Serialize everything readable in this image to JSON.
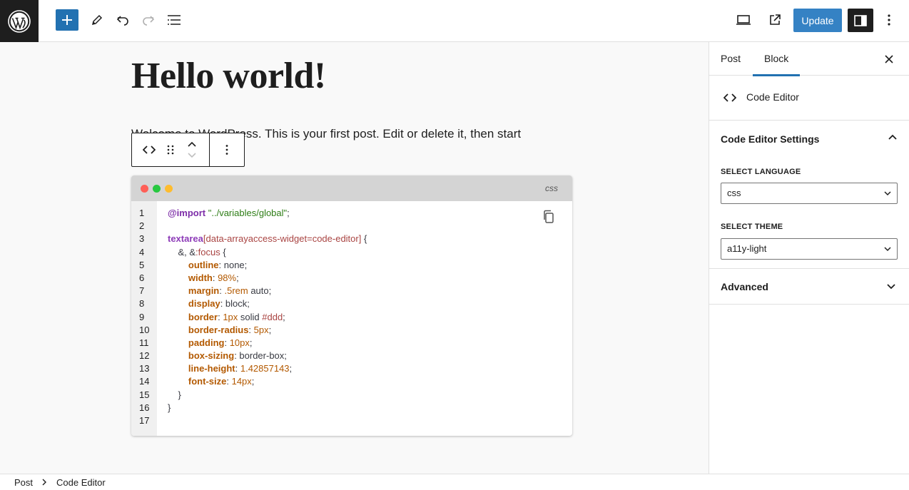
{
  "toolbar": {
    "add_icon": "plus-icon",
    "tools_icon": "pencil-icon",
    "undo_icon": "undo-icon",
    "redo_icon": "redo-icon",
    "list_view_icon": "list-view-icon",
    "preview_icon": "desktop-icon",
    "view_post_icon": "external-link-icon",
    "update_label": "Update",
    "settings_icon": "sidebar-icon",
    "options_icon": "more-vertical-icon",
    "accent": "#2271b1"
  },
  "post": {
    "title": "Hello world!",
    "paragraph": "Welcome to WordPress. This is your first post. Edit or delete it, then start"
  },
  "code_block": {
    "language": "css",
    "line_numbers": [
      "1",
      "2",
      "3",
      "4",
      "5",
      "6",
      "7",
      "8",
      "9",
      "10",
      "11",
      "12",
      "13",
      "14",
      "15",
      "16",
      "17"
    ],
    "window_dots": [
      "#ff5f57",
      "#28c840",
      "#febc2e"
    ]
  },
  "sidebar": {
    "tabs": [
      {
        "label": "Post"
      },
      {
        "label": "Block"
      }
    ],
    "block_name": "Code Editor",
    "settings_panel": {
      "title": "Code Editor Settings",
      "language_label": "SELECT LANGUAGE",
      "language_value": "css",
      "theme_label": "SELECT THEME",
      "theme_value": "a11y-light"
    },
    "advanced_panel": {
      "title": "Advanced"
    }
  },
  "breadcrumb": {
    "items": [
      "Post",
      "Code Editor"
    ]
  }
}
